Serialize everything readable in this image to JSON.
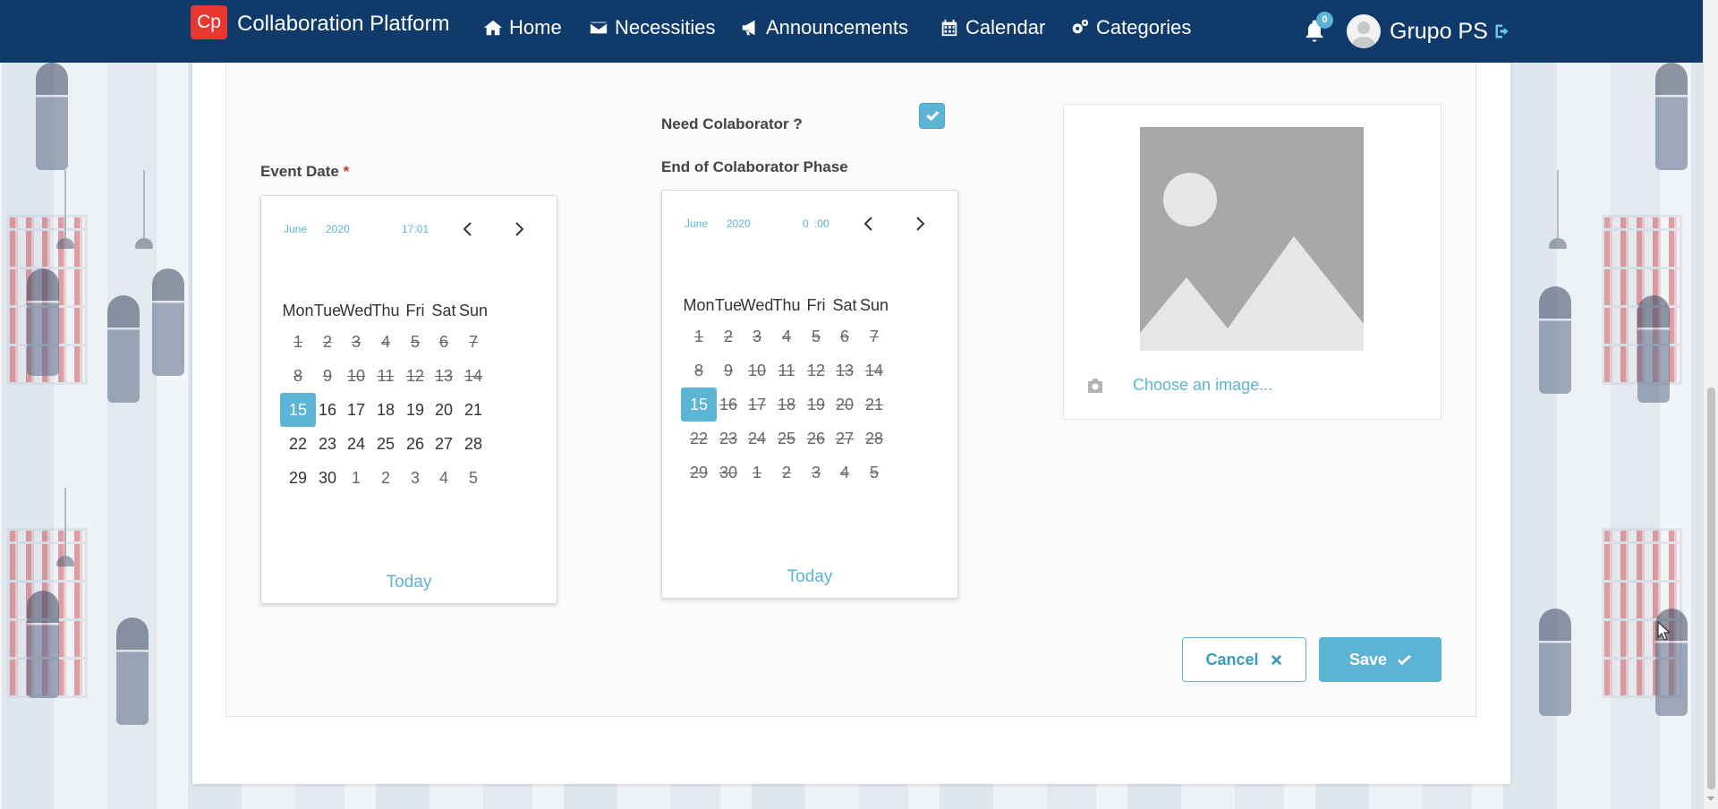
{
  "navbar": {
    "logo_text": "Cp",
    "brand": "Collaboration Platform",
    "items": [
      {
        "label": "Home",
        "icon": "home-icon"
      },
      {
        "label": "Necessities",
        "icon": "envelope-icon"
      },
      {
        "label": "Announcements",
        "icon": "bullhorn-icon"
      },
      {
        "label": "Calendar",
        "icon": "calendar-icon"
      },
      {
        "label": "Categories",
        "icon": "gears-icon"
      }
    ],
    "notification_count": "0",
    "user_name": "Grupo PS"
  },
  "form": {
    "need_collaborator_label": "Need Colaborator ?",
    "need_collaborator_checked": true,
    "event_date_label": "Event Date",
    "required_marker": "*",
    "end_phase_label": "End of Colaborator Phase"
  },
  "calendars": {
    "event": {
      "month": "June",
      "year": "2020",
      "time": "17:01",
      "weekdays": [
        "Mon",
        "Tue",
        "Wed",
        "Thu",
        "Fri",
        "Sat",
        "Sun"
      ],
      "days": [
        "1",
        "2",
        "3",
        "4",
        "5",
        "6",
        "7",
        "8",
        "9",
        "10",
        "11",
        "12",
        "13",
        "14",
        "15",
        "16",
        "17",
        "18",
        "19",
        "20",
        "21",
        "22",
        "23",
        "24",
        "25",
        "26",
        "27",
        "28",
        "29",
        "30",
        "1",
        "2",
        "3",
        "4",
        "5"
      ],
      "selected": "15",
      "today": "Today"
    },
    "phase": {
      "month": "June",
      "year": "2020",
      "time_hour": "0",
      "time_minutes": ":00",
      "weekdays": [
        "Mon",
        "Tue",
        "Wed",
        "Thu",
        "Fri",
        "Sat",
        "Sun"
      ],
      "days": [
        "1",
        "2",
        "3",
        "4",
        "5",
        "6",
        "7",
        "8",
        "9",
        "10",
        "11",
        "12",
        "13",
        "14",
        "15",
        "16",
        "17",
        "18",
        "19",
        "20",
        "21",
        "22",
        "23",
        "24",
        "25",
        "26",
        "27",
        "28",
        "29",
        "30",
        "1",
        "2",
        "3",
        "4",
        "5"
      ],
      "selected": "15",
      "today": "Today"
    }
  },
  "image": {
    "choose_label": "Choose an image..."
  },
  "actions": {
    "cancel_label": "Cancel",
    "save_label": "Save"
  },
  "colors": {
    "navbar": "#0f3a6a",
    "accent": "#5bb4d4",
    "logo": "#e8372f"
  }
}
